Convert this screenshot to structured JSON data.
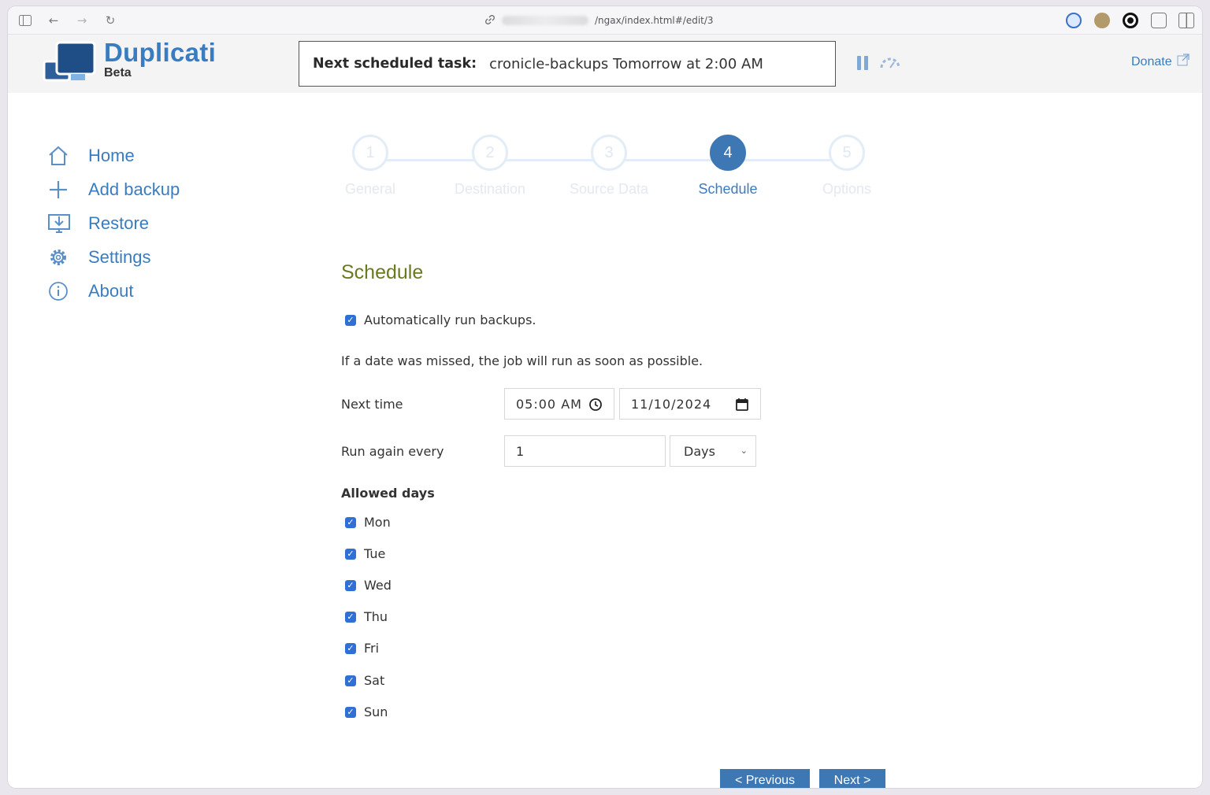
{
  "browser": {
    "url": "/ngax/index.html#/edit/3"
  },
  "header": {
    "brand_name": "Duplicati",
    "brand_sub": "Beta",
    "task_label": "Next scheduled task:",
    "task_value": "cronicle-backups Tomorrow at 2:00 AM",
    "donate_label": "Donate"
  },
  "sidebar": {
    "items": [
      {
        "label": "Home",
        "icon": "home-icon"
      },
      {
        "label": "Add backup",
        "icon": "plus-icon"
      },
      {
        "label": "Restore",
        "icon": "download-monitor-icon"
      },
      {
        "label": "Settings",
        "icon": "gear-icon"
      },
      {
        "label": "About",
        "icon": "info-icon"
      }
    ]
  },
  "stepper": {
    "steps": [
      {
        "number": "1",
        "label": "General",
        "active": false
      },
      {
        "number": "2",
        "label": "Destination",
        "active": false
      },
      {
        "number": "3",
        "label": "Source Data",
        "active": false
      },
      {
        "number": "4",
        "label": "Schedule",
        "active": true
      },
      {
        "number": "5",
        "label": "Options",
        "active": false
      }
    ]
  },
  "form": {
    "title": "Schedule",
    "auto_run_label": "Automatically run backups.",
    "auto_run_checked": true,
    "hint": "If a date was missed, the job will run as soon as possible.",
    "next_time_label": "Next time",
    "next_time_value": "05:00 AM",
    "next_date_value": "11/10/2024",
    "run_again_label": "Run again every",
    "run_again_value": "1",
    "run_again_unit": "Days",
    "allowed_days_label": "Allowed days",
    "days": [
      {
        "label": "Mon",
        "checked": true
      },
      {
        "label": "Tue",
        "checked": true
      },
      {
        "label": "Wed",
        "checked": true
      },
      {
        "label": "Thu",
        "checked": true
      },
      {
        "label": "Fri",
        "checked": true
      },
      {
        "label": "Sat",
        "checked": true
      },
      {
        "label": "Sun",
        "checked": true
      }
    ]
  },
  "footer": {
    "previous_label": "< Previous",
    "next_label": "Next >"
  },
  "colors": {
    "accent": "#3a7cc0",
    "active_step": "#3d78b5",
    "section_title": "#6a7a1f",
    "checkbox": "#2f6fd6"
  }
}
